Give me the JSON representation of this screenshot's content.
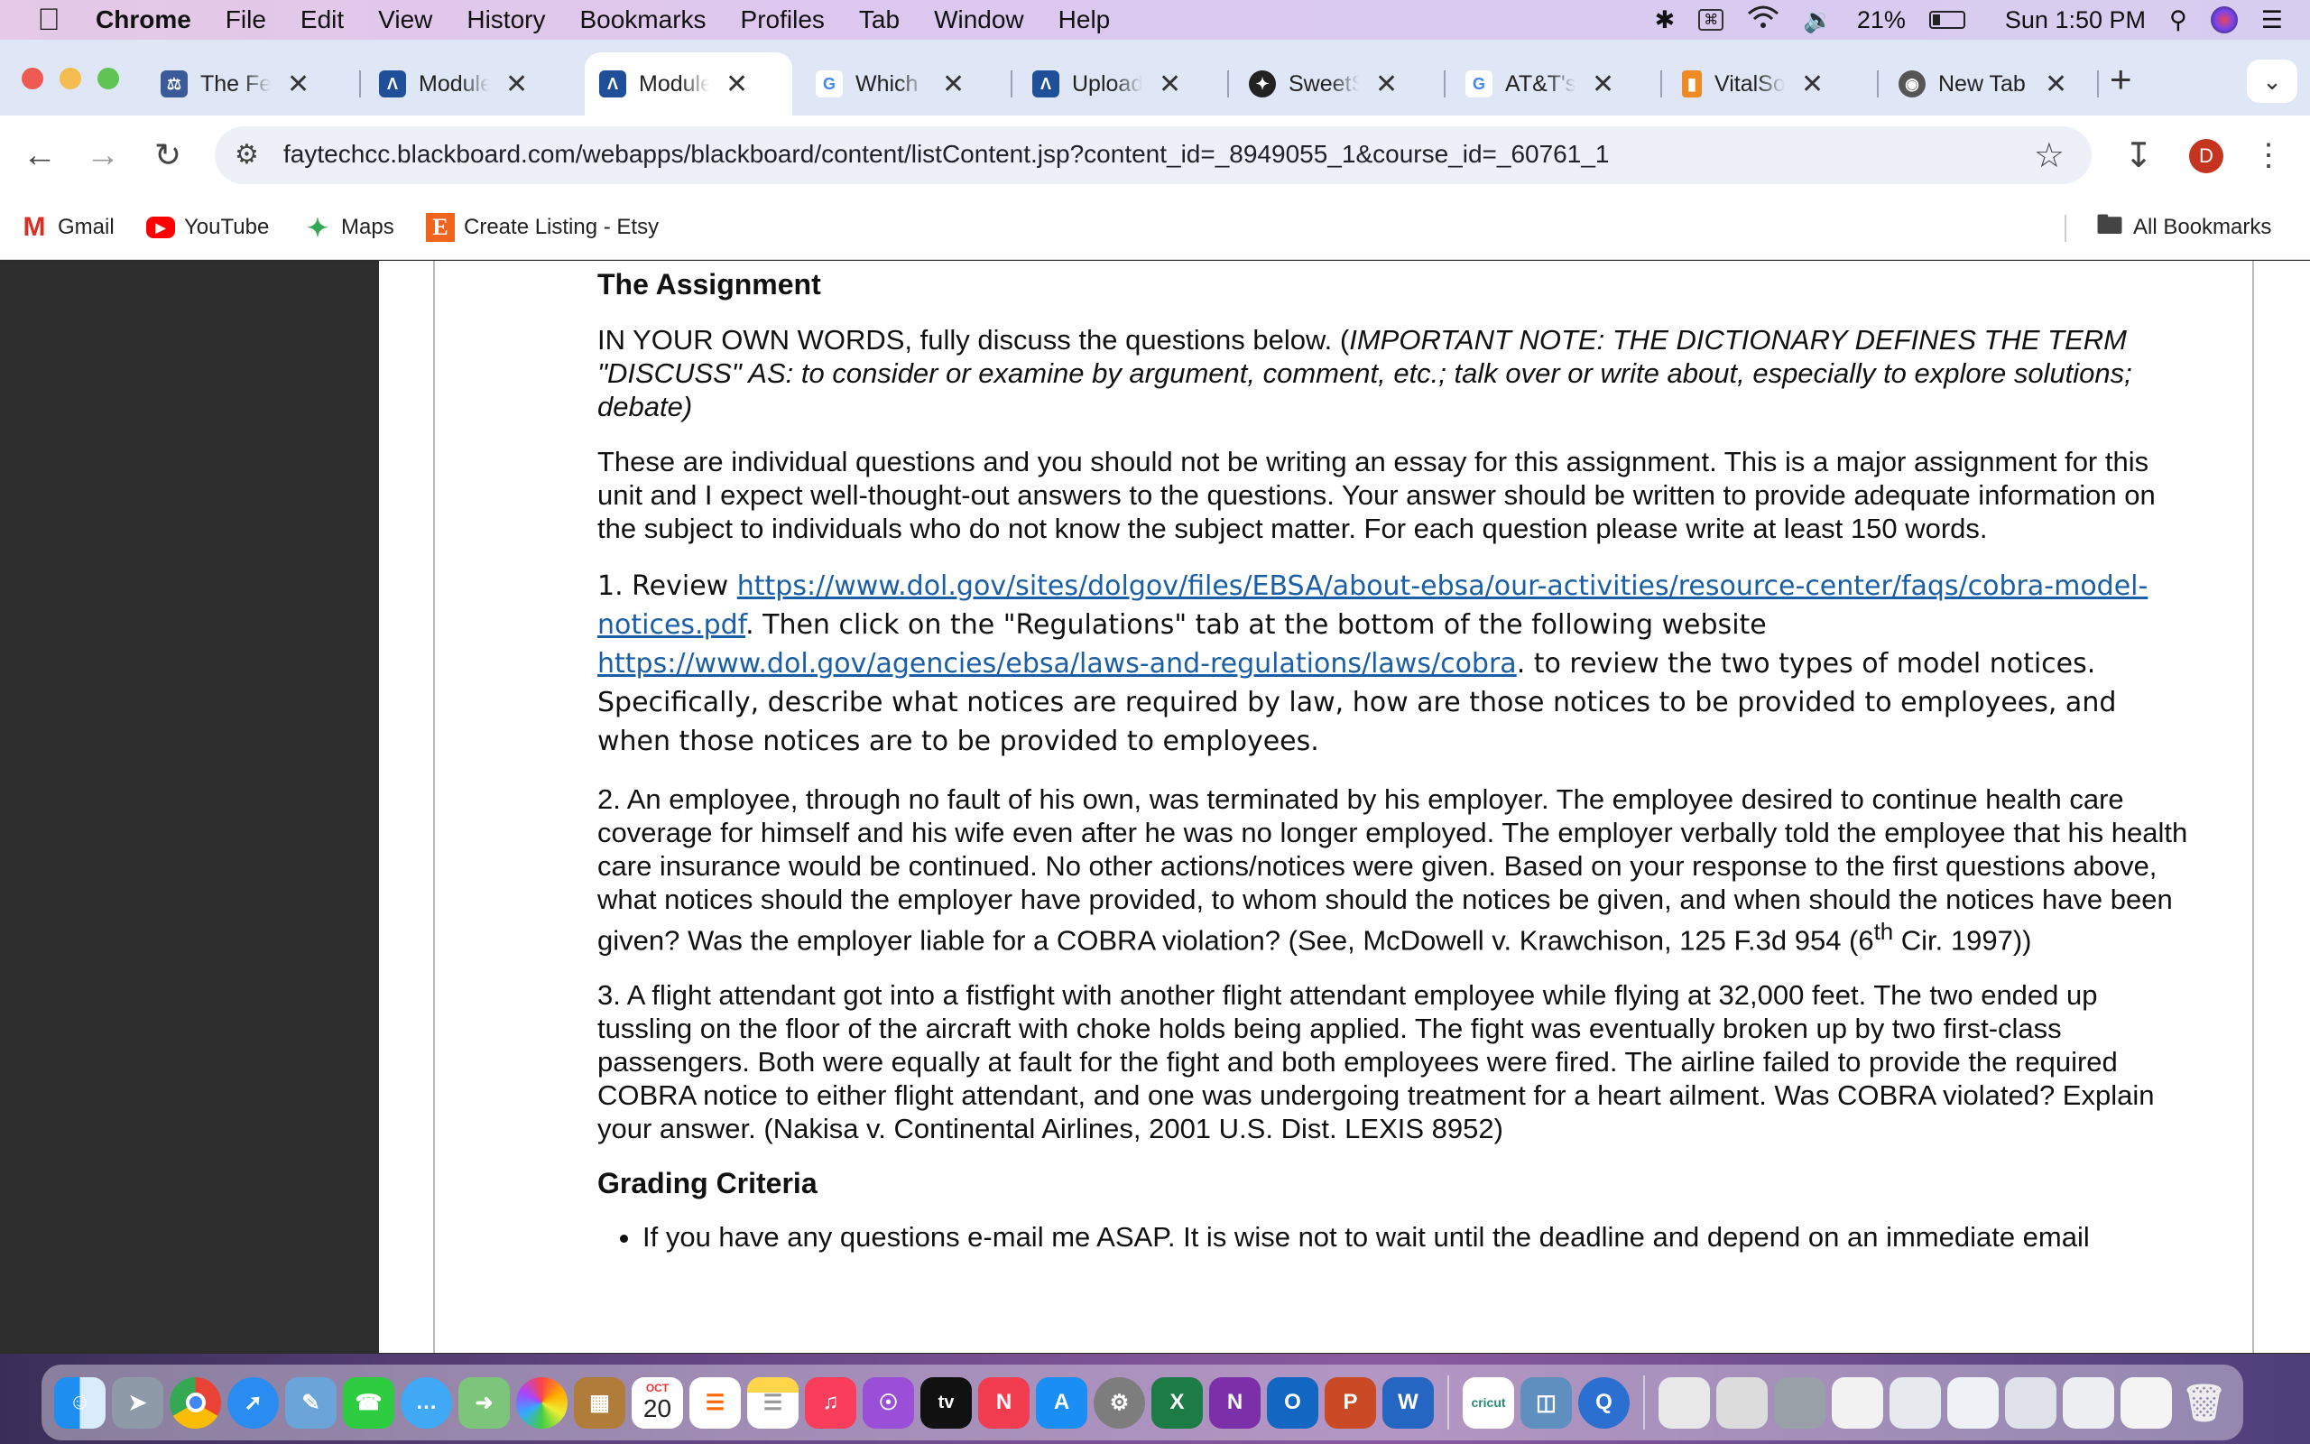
{
  "menubar": {
    "app": "Chrome",
    "items": [
      "File",
      "Edit",
      "View",
      "History",
      "Bookmarks",
      "Profiles",
      "Tab",
      "Window",
      "Help"
    ],
    "battery": "21%",
    "clock": "Sun 1:50 PM"
  },
  "tabs": [
    {
      "label": "The Fede",
      "icon": "federal-seal-icon",
      "color": "#3b5a9a"
    },
    {
      "label": "Module S",
      "icon": "blackboard-icon",
      "color": "#1f4f99"
    },
    {
      "label": "Module S",
      "icon": "blackboard-icon",
      "color": "#1f4f99",
      "active": true
    },
    {
      "label": "Which of",
      "icon": "google-icon",
      "color": "#4285f4"
    },
    {
      "label": "Upload A",
      "icon": "blackboard-icon",
      "color": "#1f4f99"
    },
    {
      "label": "SweetSt",
      "icon": "sweetstudy-icon",
      "color": "#222222"
    },
    {
      "label": "AT&T's s",
      "icon": "google-icon",
      "color": "#4285f4"
    },
    {
      "label": "VitalSou",
      "icon": "vitalsource-icon",
      "color": "#f08a24"
    },
    {
      "label": "New Tab",
      "icon": "chrome-icon",
      "color": "#555555"
    }
  ],
  "toolbar": {
    "url": "faytechcc.blackboard.com/webapps/blackboard/content/listContent.jsp?content_id=_8949055_1&course_id=_60761_1",
    "profile_initial": "D"
  },
  "bookmarks": {
    "items": [
      "Gmail",
      "YouTube",
      "Maps",
      "Create Listing - Etsy"
    ],
    "all": "All Bookmarks"
  },
  "doc": {
    "heading": "The Assignment",
    "intro_a": "IN YOUR OWN WORDS, fully discuss the questions below.  (",
    "intro_b": "IMPORTANT NOTE: THE DICTIONARY DEFINES THE TERM \"DISCUSS\" AS: ",
    "intro_c": "to consider or examine by argument, comment, etc.; talk over or write about, especially to explore solutions; debate)",
    "para2": "These are individual questions and you should not be writing an essay for this assignment.   This is a major assignment for this unit and I expect well-thought-out answers to the questions. Your answer should be written to provide adequate information on the subject to individuals who do not know the subject matter. For each question please write at least 150 words.",
    "q1_a": "1.  Review ",
    "q1_link1": "https://www.dol.gov/sites/dolgov/files/EBSA/about-ebsa/our-activities/resource-center/faqs/cobra-model-notices.pdf",
    "q1_b": ".  Then click on the \"Regulations\" tab at the bottom of the following website ",
    "q1_link2": "https://www.dol.gov/agencies/ebsa/laws-and-regulations/laws/cobra",
    "q1_c": ".  to review the two types of model notices.  Specifically, describe what notices are required by law, how are those notices to be provided to employees, and when those notices are to be provided to employees.",
    "q2_a": "2.  An employee, through no fault of his own, was terminated by his employer.  The employee desired to continue health care coverage for himself and his wife even after he was no longer employed.  The employer verbally told the employee that his health care insurance would be continued.  No other actions/notices were given.    Based on your response to the first questions above, what notices should the employer have provided, to whom should the notices be given, and when should the notices have been given? Was the employer liable for a COBRA violation? (See, McDowell v. Krawchison, 125 F.3d 954 (6",
    "q2_sup": "th",
    "q2_b": " Cir. 1997))",
    "q3": "3. A flight attendant got into a fistfight with another flight attendant employee while flying at 32,000 feet.  The two ended up tussling on the floor of the aircraft with choke holds being applied.  The fight was eventually broken up by two first-class passengers.  Both were equally at fault for the fight and both employees were fired.  The airline failed to provide the required COBRA notice to either flight attendant, and one was undergoing treatment for a heart ailment.  Was COBRA violated? Explain your answer. (Nakisa v. Continental Airlines, 2001 U.S. Dist. LEXIS 8952)",
    "grading_heading": "Grading Criteria",
    "bullet1": "If you have any questions e-mail me ASAP.  It is wise not to wait until the deadline and depend on an immediate email"
  },
  "dock": {
    "calendar_month": "OCT",
    "calendar_day": "20",
    "tv_label": "tv",
    "cricut_label": "cricut"
  }
}
